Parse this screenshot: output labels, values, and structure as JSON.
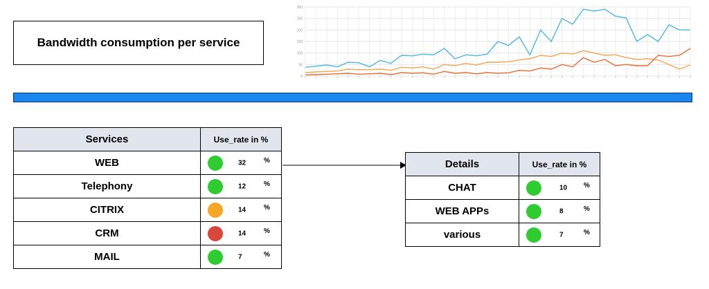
{
  "title": "Bandwidth consumption per service",
  "services_table": {
    "headers": [
      "Services",
      "Use_rate in %"
    ],
    "rows": [
      {
        "name": "WEB",
        "rate": "32",
        "unit": "%",
        "status_color": "#2ecc2e"
      },
      {
        "name": "Telephony",
        "rate": "12",
        "unit": "%",
        "status_color": "#2ecc2e"
      },
      {
        "name": "CITRIX",
        "rate": "14",
        "unit": "%",
        "status_color": "#f5a623"
      },
      {
        "name": "CRM",
        "rate": "14",
        "unit": "%",
        "status_color": "#d9473a"
      },
      {
        "name": "MAIL",
        "rate": "7",
        "unit": "%",
        "status_color": "#2ecc2e"
      }
    ]
  },
  "details_table": {
    "headers": [
      "Details",
      "Use_rate in %"
    ],
    "rows": [
      {
        "name": "CHAT",
        "rate": "10",
        "unit": "%",
        "status_color": "#2ecc2e"
      },
      {
        "name": "WEB APPs",
        "rate": "8",
        "unit": "%",
        "status_color": "#2ecc2e"
      },
      {
        "name": "various",
        "rate": "7",
        "unit": "%",
        "status_color": "#2ecc2e"
      }
    ]
  },
  "colors": {
    "header_bg": "#e1e5ee",
    "bar_blue": "#1a86f0"
  },
  "chart_data": {
    "type": "line",
    "ylim": [
      0,
      300
    ],
    "yticks": [
      0,
      50,
      100,
      150,
      200,
      250,
      300
    ],
    "x": [
      1,
      2,
      3,
      4,
      5,
      6,
      7,
      8,
      9,
      10,
      11,
      12,
      13,
      14,
      15,
      16,
      17,
      18,
      19,
      20,
      21,
      22,
      23,
      24,
      25,
      26,
      27,
      28,
      29,
      30,
      31,
      32,
      33,
      34,
      35,
      36,
      37
    ],
    "grid": true,
    "series": [
      {
        "color": "#4bb8e3",
        "values": [
          38,
          43,
          48,
          40,
          60,
          58,
          40,
          68,
          55,
          90,
          88,
          95,
          92,
          120,
          75,
          92,
          88,
          95,
          150,
          133,
          170,
          92,
          200,
          150,
          250,
          225,
          290,
          282,
          290,
          260,
          252,
          150,
          180,
          150,
          222,
          200,
          200
        ]
      },
      {
        "color": "#f6a54d",
        "values": [
          15,
          18,
          20,
          22,
          30,
          28,
          28,
          30,
          25,
          38,
          35,
          40,
          30,
          50,
          45,
          55,
          48,
          60,
          60,
          62,
          70,
          75,
          90,
          85,
          100,
          95,
          110,
          100,
          90,
          92,
          80,
          72,
          75,
          70,
          50,
          30,
          48
        ]
      },
      {
        "color": "#ec6b33",
        "values": [
          5,
          6,
          8,
          10,
          12,
          8,
          10,
          12,
          6,
          15,
          12,
          14,
          8,
          20,
          12,
          15,
          10,
          15,
          12,
          14,
          25,
          22,
          35,
          30,
          50,
          40,
          80,
          60,
          72,
          45,
          50,
          45,
          45,
          90,
          85,
          90,
          120
        ]
      }
    ]
  }
}
